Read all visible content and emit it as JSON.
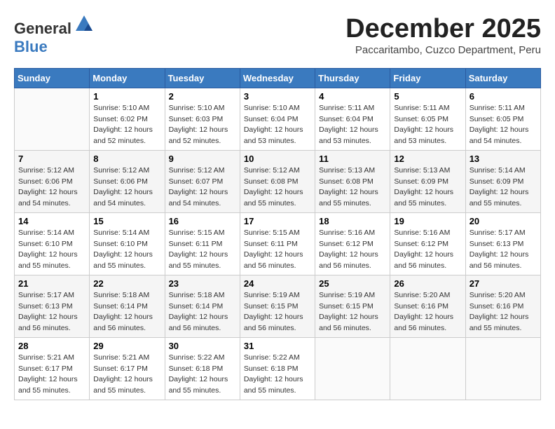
{
  "header": {
    "logo_general": "General",
    "logo_blue": "Blue",
    "month_title": "December 2025",
    "subtitle": "Paccaritambo, Cuzco Department, Peru"
  },
  "days_of_week": [
    "Sunday",
    "Monday",
    "Tuesday",
    "Wednesday",
    "Thursday",
    "Friday",
    "Saturday"
  ],
  "weeks": [
    [
      {
        "day": "",
        "detail": ""
      },
      {
        "day": "1",
        "detail": "Sunrise: 5:10 AM\nSunset: 6:02 PM\nDaylight: 12 hours\nand 52 minutes."
      },
      {
        "day": "2",
        "detail": "Sunrise: 5:10 AM\nSunset: 6:03 PM\nDaylight: 12 hours\nand 52 minutes."
      },
      {
        "day": "3",
        "detail": "Sunrise: 5:10 AM\nSunset: 6:04 PM\nDaylight: 12 hours\nand 53 minutes."
      },
      {
        "day": "4",
        "detail": "Sunrise: 5:11 AM\nSunset: 6:04 PM\nDaylight: 12 hours\nand 53 minutes."
      },
      {
        "day": "5",
        "detail": "Sunrise: 5:11 AM\nSunset: 6:05 PM\nDaylight: 12 hours\nand 53 minutes."
      },
      {
        "day": "6",
        "detail": "Sunrise: 5:11 AM\nSunset: 6:05 PM\nDaylight: 12 hours\nand 54 minutes."
      }
    ],
    [
      {
        "day": "7",
        "detail": "Sunrise: 5:12 AM\nSunset: 6:06 PM\nDaylight: 12 hours\nand 54 minutes."
      },
      {
        "day": "8",
        "detail": "Sunrise: 5:12 AM\nSunset: 6:06 PM\nDaylight: 12 hours\nand 54 minutes."
      },
      {
        "day": "9",
        "detail": "Sunrise: 5:12 AM\nSunset: 6:07 PM\nDaylight: 12 hours\nand 54 minutes."
      },
      {
        "day": "10",
        "detail": "Sunrise: 5:12 AM\nSunset: 6:08 PM\nDaylight: 12 hours\nand 55 minutes."
      },
      {
        "day": "11",
        "detail": "Sunrise: 5:13 AM\nSunset: 6:08 PM\nDaylight: 12 hours\nand 55 minutes."
      },
      {
        "day": "12",
        "detail": "Sunrise: 5:13 AM\nSunset: 6:09 PM\nDaylight: 12 hours\nand 55 minutes."
      },
      {
        "day": "13",
        "detail": "Sunrise: 5:14 AM\nSunset: 6:09 PM\nDaylight: 12 hours\nand 55 minutes."
      }
    ],
    [
      {
        "day": "14",
        "detail": "Sunrise: 5:14 AM\nSunset: 6:10 PM\nDaylight: 12 hours\nand 55 minutes."
      },
      {
        "day": "15",
        "detail": "Sunrise: 5:14 AM\nSunset: 6:10 PM\nDaylight: 12 hours\nand 55 minutes."
      },
      {
        "day": "16",
        "detail": "Sunrise: 5:15 AM\nSunset: 6:11 PM\nDaylight: 12 hours\nand 55 minutes."
      },
      {
        "day": "17",
        "detail": "Sunrise: 5:15 AM\nSunset: 6:11 PM\nDaylight: 12 hours\nand 56 minutes."
      },
      {
        "day": "18",
        "detail": "Sunrise: 5:16 AM\nSunset: 6:12 PM\nDaylight: 12 hours\nand 56 minutes."
      },
      {
        "day": "19",
        "detail": "Sunrise: 5:16 AM\nSunset: 6:12 PM\nDaylight: 12 hours\nand 56 minutes."
      },
      {
        "day": "20",
        "detail": "Sunrise: 5:17 AM\nSunset: 6:13 PM\nDaylight: 12 hours\nand 56 minutes."
      }
    ],
    [
      {
        "day": "21",
        "detail": "Sunrise: 5:17 AM\nSunset: 6:13 PM\nDaylight: 12 hours\nand 56 minutes."
      },
      {
        "day": "22",
        "detail": "Sunrise: 5:18 AM\nSunset: 6:14 PM\nDaylight: 12 hours\nand 56 minutes."
      },
      {
        "day": "23",
        "detail": "Sunrise: 5:18 AM\nSunset: 6:14 PM\nDaylight: 12 hours\nand 56 minutes."
      },
      {
        "day": "24",
        "detail": "Sunrise: 5:19 AM\nSunset: 6:15 PM\nDaylight: 12 hours\nand 56 minutes."
      },
      {
        "day": "25",
        "detail": "Sunrise: 5:19 AM\nSunset: 6:15 PM\nDaylight: 12 hours\nand 56 minutes."
      },
      {
        "day": "26",
        "detail": "Sunrise: 5:20 AM\nSunset: 6:16 PM\nDaylight: 12 hours\nand 56 minutes."
      },
      {
        "day": "27",
        "detail": "Sunrise: 5:20 AM\nSunset: 6:16 PM\nDaylight: 12 hours\nand 55 minutes."
      }
    ],
    [
      {
        "day": "28",
        "detail": "Sunrise: 5:21 AM\nSunset: 6:17 PM\nDaylight: 12 hours\nand 55 minutes."
      },
      {
        "day": "29",
        "detail": "Sunrise: 5:21 AM\nSunset: 6:17 PM\nDaylight: 12 hours\nand 55 minutes."
      },
      {
        "day": "30",
        "detail": "Sunrise: 5:22 AM\nSunset: 6:18 PM\nDaylight: 12 hours\nand 55 minutes."
      },
      {
        "day": "31",
        "detail": "Sunrise: 5:22 AM\nSunset: 6:18 PM\nDaylight: 12 hours\nand 55 minutes."
      },
      {
        "day": "",
        "detail": ""
      },
      {
        "day": "",
        "detail": ""
      },
      {
        "day": "",
        "detail": ""
      }
    ]
  ]
}
